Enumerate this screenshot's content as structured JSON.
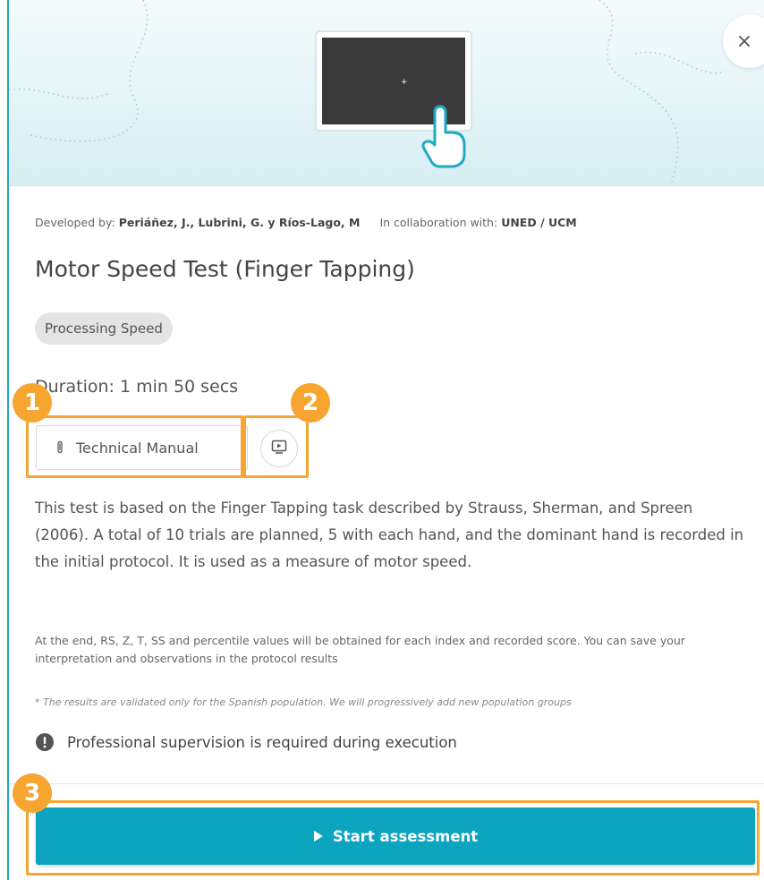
{
  "modal": {
    "close_symbol": "×",
    "credits": {
      "developed_label": "Developed by:",
      "developers": "Periáñez, J., Lubrini, G. y Ríos-Lago, M",
      "collab_label": "In collaboration with:",
      "collaborators": "UNED / UCM"
    },
    "title": "Motor Speed Test (Finger Tapping)",
    "tag": "Processing Speed",
    "duration": "Duration: 1 min 50 secs",
    "technical_manual_label": "Technical Manual",
    "description": "This test is based on the Finger Tapping task described by Strauss, Sherman, and Spreen (2006). A total of 10 trials are planned, 5 with each hand, and the dominant hand is recorded in the initial protocol. It is used as a measure of motor speed.",
    "results_text": "At the end, RS, Z, T, SS and percentile values will be obtained for each index and recorded score. You can save your interpretation and observations in the protocol results",
    "population_note": "* The results are validated only for the Spanish population. We will progressively add new population groups",
    "supervision_text": "Professional supervision is required during execution",
    "start_label": "Start assessment"
  },
  "callouts": [
    "1",
    "2",
    "3"
  ],
  "colors": {
    "accent": "#0da4c0",
    "callout": "#f7a531",
    "modal_border": "#29a8c4"
  },
  "icons": [
    "close-icon",
    "tablet-illustration",
    "tap-hand-icon",
    "paperclip-icon",
    "video-play-icon",
    "info-icon",
    "play-icon"
  ]
}
